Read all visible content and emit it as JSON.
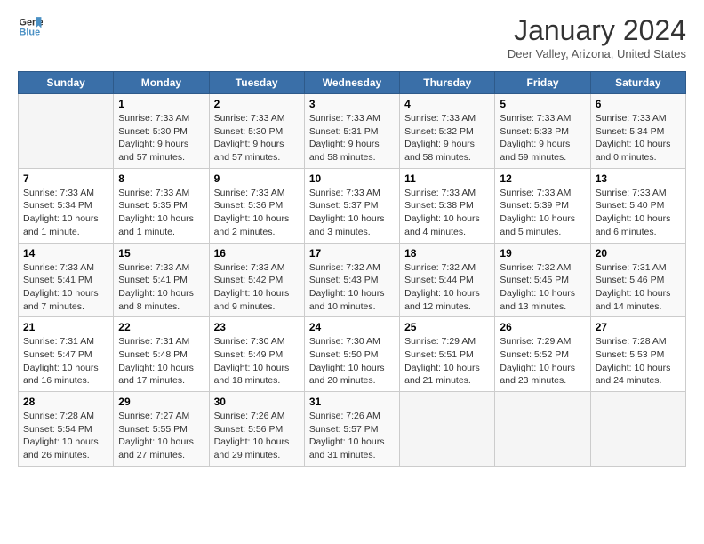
{
  "logo": {
    "line1": "General",
    "line2": "Blue"
  },
  "title": "January 2024",
  "subtitle": "Deer Valley, Arizona, United States",
  "days_of_week": [
    "Sunday",
    "Monday",
    "Tuesday",
    "Wednesday",
    "Thursday",
    "Friday",
    "Saturday"
  ],
  "weeks": [
    [
      {
        "num": "",
        "info": ""
      },
      {
        "num": "1",
        "info": "Sunrise: 7:33 AM\nSunset: 5:30 PM\nDaylight: 9 hours\nand 57 minutes."
      },
      {
        "num": "2",
        "info": "Sunrise: 7:33 AM\nSunset: 5:30 PM\nDaylight: 9 hours\nand 57 minutes."
      },
      {
        "num": "3",
        "info": "Sunrise: 7:33 AM\nSunset: 5:31 PM\nDaylight: 9 hours\nand 58 minutes."
      },
      {
        "num": "4",
        "info": "Sunrise: 7:33 AM\nSunset: 5:32 PM\nDaylight: 9 hours\nand 58 minutes."
      },
      {
        "num": "5",
        "info": "Sunrise: 7:33 AM\nSunset: 5:33 PM\nDaylight: 9 hours\nand 59 minutes."
      },
      {
        "num": "6",
        "info": "Sunrise: 7:33 AM\nSunset: 5:34 PM\nDaylight: 10 hours\nand 0 minutes."
      }
    ],
    [
      {
        "num": "7",
        "info": "Sunrise: 7:33 AM\nSunset: 5:34 PM\nDaylight: 10 hours\nand 1 minute."
      },
      {
        "num": "8",
        "info": "Sunrise: 7:33 AM\nSunset: 5:35 PM\nDaylight: 10 hours\nand 1 minute."
      },
      {
        "num": "9",
        "info": "Sunrise: 7:33 AM\nSunset: 5:36 PM\nDaylight: 10 hours\nand 2 minutes."
      },
      {
        "num": "10",
        "info": "Sunrise: 7:33 AM\nSunset: 5:37 PM\nDaylight: 10 hours\nand 3 minutes."
      },
      {
        "num": "11",
        "info": "Sunrise: 7:33 AM\nSunset: 5:38 PM\nDaylight: 10 hours\nand 4 minutes."
      },
      {
        "num": "12",
        "info": "Sunrise: 7:33 AM\nSunset: 5:39 PM\nDaylight: 10 hours\nand 5 minutes."
      },
      {
        "num": "13",
        "info": "Sunrise: 7:33 AM\nSunset: 5:40 PM\nDaylight: 10 hours\nand 6 minutes."
      }
    ],
    [
      {
        "num": "14",
        "info": "Sunrise: 7:33 AM\nSunset: 5:41 PM\nDaylight: 10 hours\nand 7 minutes."
      },
      {
        "num": "15",
        "info": "Sunrise: 7:33 AM\nSunset: 5:41 PM\nDaylight: 10 hours\nand 8 minutes."
      },
      {
        "num": "16",
        "info": "Sunrise: 7:33 AM\nSunset: 5:42 PM\nDaylight: 10 hours\nand 9 minutes."
      },
      {
        "num": "17",
        "info": "Sunrise: 7:32 AM\nSunset: 5:43 PM\nDaylight: 10 hours\nand 10 minutes."
      },
      {
        "num": "18",
        "info": "Sunrise: 7:32 AM\nSunset: 5:44 PM\nDaylight: 10 hours\nand 12 minutes."
      },
      {
        "num": "19",
        "info": "Sunrise: 7:32 AM\nSunset: 5:45 PM\nDaylight: 10 hours\nand 13 minutes."
      },
      {
        "num": "20",
        "info": "Sunrise: 7:31 AM\nSunset: 5:46 PM\nDaylight: 10 hours\nand 14 minutes."
      }
    ],
    [
      {
        "num": "21",
        "info": "Sunrise: 7:31 AM\nSunset: 5:47 PM\nDaylight: 10 hours\nand 16 minutes."
      },
      {
        "num": "22",
        "info": "Sunrise: 7:31 AM\nSunset: 5:48 PM\nDaylight: 10 hours\nand 17 minutes."
      },
      {
        "num": "23",
        "info": "Sunrise: 7:30 AM\nSunset: 5:49 PM\nDaylight: 10 hours\nand 18 minutes."
      },
      {
        "num": "24",
        "info": "Sunrise: 7:30 AM\nSunset: 5:50 PM\nDaylight: 10 hours\nand 20 minutes."
      },
      {
        "num": "25",
        "info": "Sunrise: 7:29 AM\nSunset: 5:51 PM\nDaylight: 10 hours\nand 21 minutes."
      },
      {
        "num": "26",
        "info": "Sunrise: 7:29 AM\nSunset: 5:52 PM\nDaylight: 10 hours\nand 23 minutes."
      },
      {
        "num": "27",
        "info": "Sunrise: 7:28 AM\nSunset: 5:53 PM\nDaylight: 10 hours\nand 24 minutes."
      }
    ],
    [
      {
        "num": "28",
        "info": "Sunrise: 7:28 AM\nSunset: 5:54 PM\nDaylight: 10 hours\nand 26 minutes."
      },
      {
        "num": "29",
        "info": "Sunrise: 7:27 AM\nSunset: 5:55 PM\nDaylight: 10 hours\nand 27 minutes."
      },
      {
        "num": "30",
        "info": "Sunrise: 7:26 AM\nSunset: 5:56 PM\nDaylight: 10 hours\nand 29 minutes."
      },
      {
        "num": "31",
        "info": "Sunrise: 7:26 AM\nSunset: 5:57 PM\nDaylight: 10 hours\nand 31 minutes."
      },
      {
        "num": "",
        "info": ""
      },
      {
        "num": "",
        "info": ""
      },
      {
        "num": "",
        "info": ""
      }
    ]
  ]
}
